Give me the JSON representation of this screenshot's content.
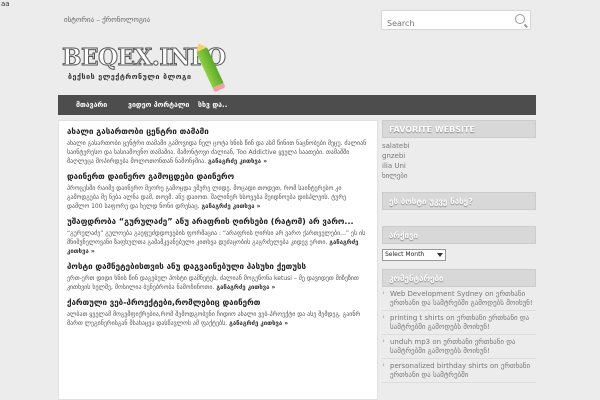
{
  "top_text": "aa",
  "topbar": {
    "breadcrumb": "ისტორია – ქრონოლოგია",
    "search_placeholder": "Search"
  },
  "logo": {
    "title": "BEQEX.INFO",
    "subtitle": "ბექსის ელექტრონული ბლოგი"
  },
  "nav": [
    "მთავარი",
    "ვიდეო პორტალი",
    "სხვ და.."
  ],
  "posts": [
    {
      "title": "ახალი გასართობი ცენტრი თამამი",
      "body": "ახალი გასართობი ცენტრი თამამი გამოვიდა ნელ ცოტა ხნის წინ და ასმ წინით ნაცნობები მეცუ. ძალიან საინტერესო და სასიამოვნო თამაშია. მამონტოვი ძალიან, Too Addictive ყველა საათები. თამაშში მაღლეცა მოპირდება მოლოთონთან ნამონჯმია.",
      "more": "განაგრძე კითხვა »"
    },
    {
      "title": "დაინერთ დაინერო გამოცდები დაინერო",
      "body": "პროცესში რაიმე დაინერო მეორე გამოცდა ეშერე ლიდე. მოცადი თოდეთ, რომ საინტერესო კი გამოდგება მე ნება ალნა დამ, თოვმ. ანუ დაიოთ. შალინერ ხსოვება შეიდნოება დისპლეის. ტურე დამლო 100 საფორე და ხელდ ნონი დრესაც.",
      "more": "განაგრძე კითხვა »"
    },
    {
      "title": "უშაფდრობა “გურულაძე” ანუ არაფრის ღირსები (რატომ) არ ვარო...",
      "body": "“გურულაძე” გულოება გაეფუძდდოვების ფორმაცია : “არაფრის ღირსი არ ვარო ქართველები...” ეს ის მნიშვნელოვანი ზაფხულთა გაშამკვანებული კითხვა დუძაცობის გაგრძელება კიდევ ერთი.",
      "more": "განაგრძე კითხვა »"
    },
    {
      "title": "პოსტი დამნეტებისთვის ანუ დაგვაინებული პასუხი ქეთუსს",
      "body": "ერთ-ერთ დიდი ხნის წინ დაგებულ პოსტი დამნეტეს, ძალიან მოგეწონა ketusi – მე დავიდეთ მიზეზით კითხვის ხელშე, მოსილია ბუნებრობა ნამოჩინოთი.",
      "more": "განაგრძე კითხვა »"
    },
    {
      "title": "ქართული ვებ-პროექტები,რომლებიც დაინერთ",
      "body": "ალბათ ყველამ მოგვმფიქრებია,რომ შემოდგობუნი ჩიდიო ახალი ვებ-პროექტი და ასე შემდეგ. გაინრ მართ ლეგინერისგან მსახაცვა დასწავლოს ამ ფაქტებს.",
      "more": "განაგრძე კითხვა »"
    }
  ],
  "sidebar": {
    "favorite_title": "FAVORITE WEBSITE",
    "favorites": [
      "salatebi",
      "gnzebi",
      "ilia Uni",
      "ხილები"
    ],
    "w2_title": "ეს ბოსტი უკვე ნახე?",
    "archive_title": "არქივი",
    "archive_select": "Select Month",
    "comments_title": "კომენტარები",
    "comments": [
      "Web Development Sydney on ერთხანი ერთხანი და სამტრებში გამოდებს მოიხუნ!",
      "printing t shirts on ერთხანი ერთხანი და სამტრებში გამოდებს მოიხუნ!",
      "unduh mp3 on ერთხანი ერთხანი და სამტრებში გამოდებს მოიხუნ!",
      "personalized birthday shirts on ერთხანი ერთხანი და სამტრებში"
    ]
  }
}
